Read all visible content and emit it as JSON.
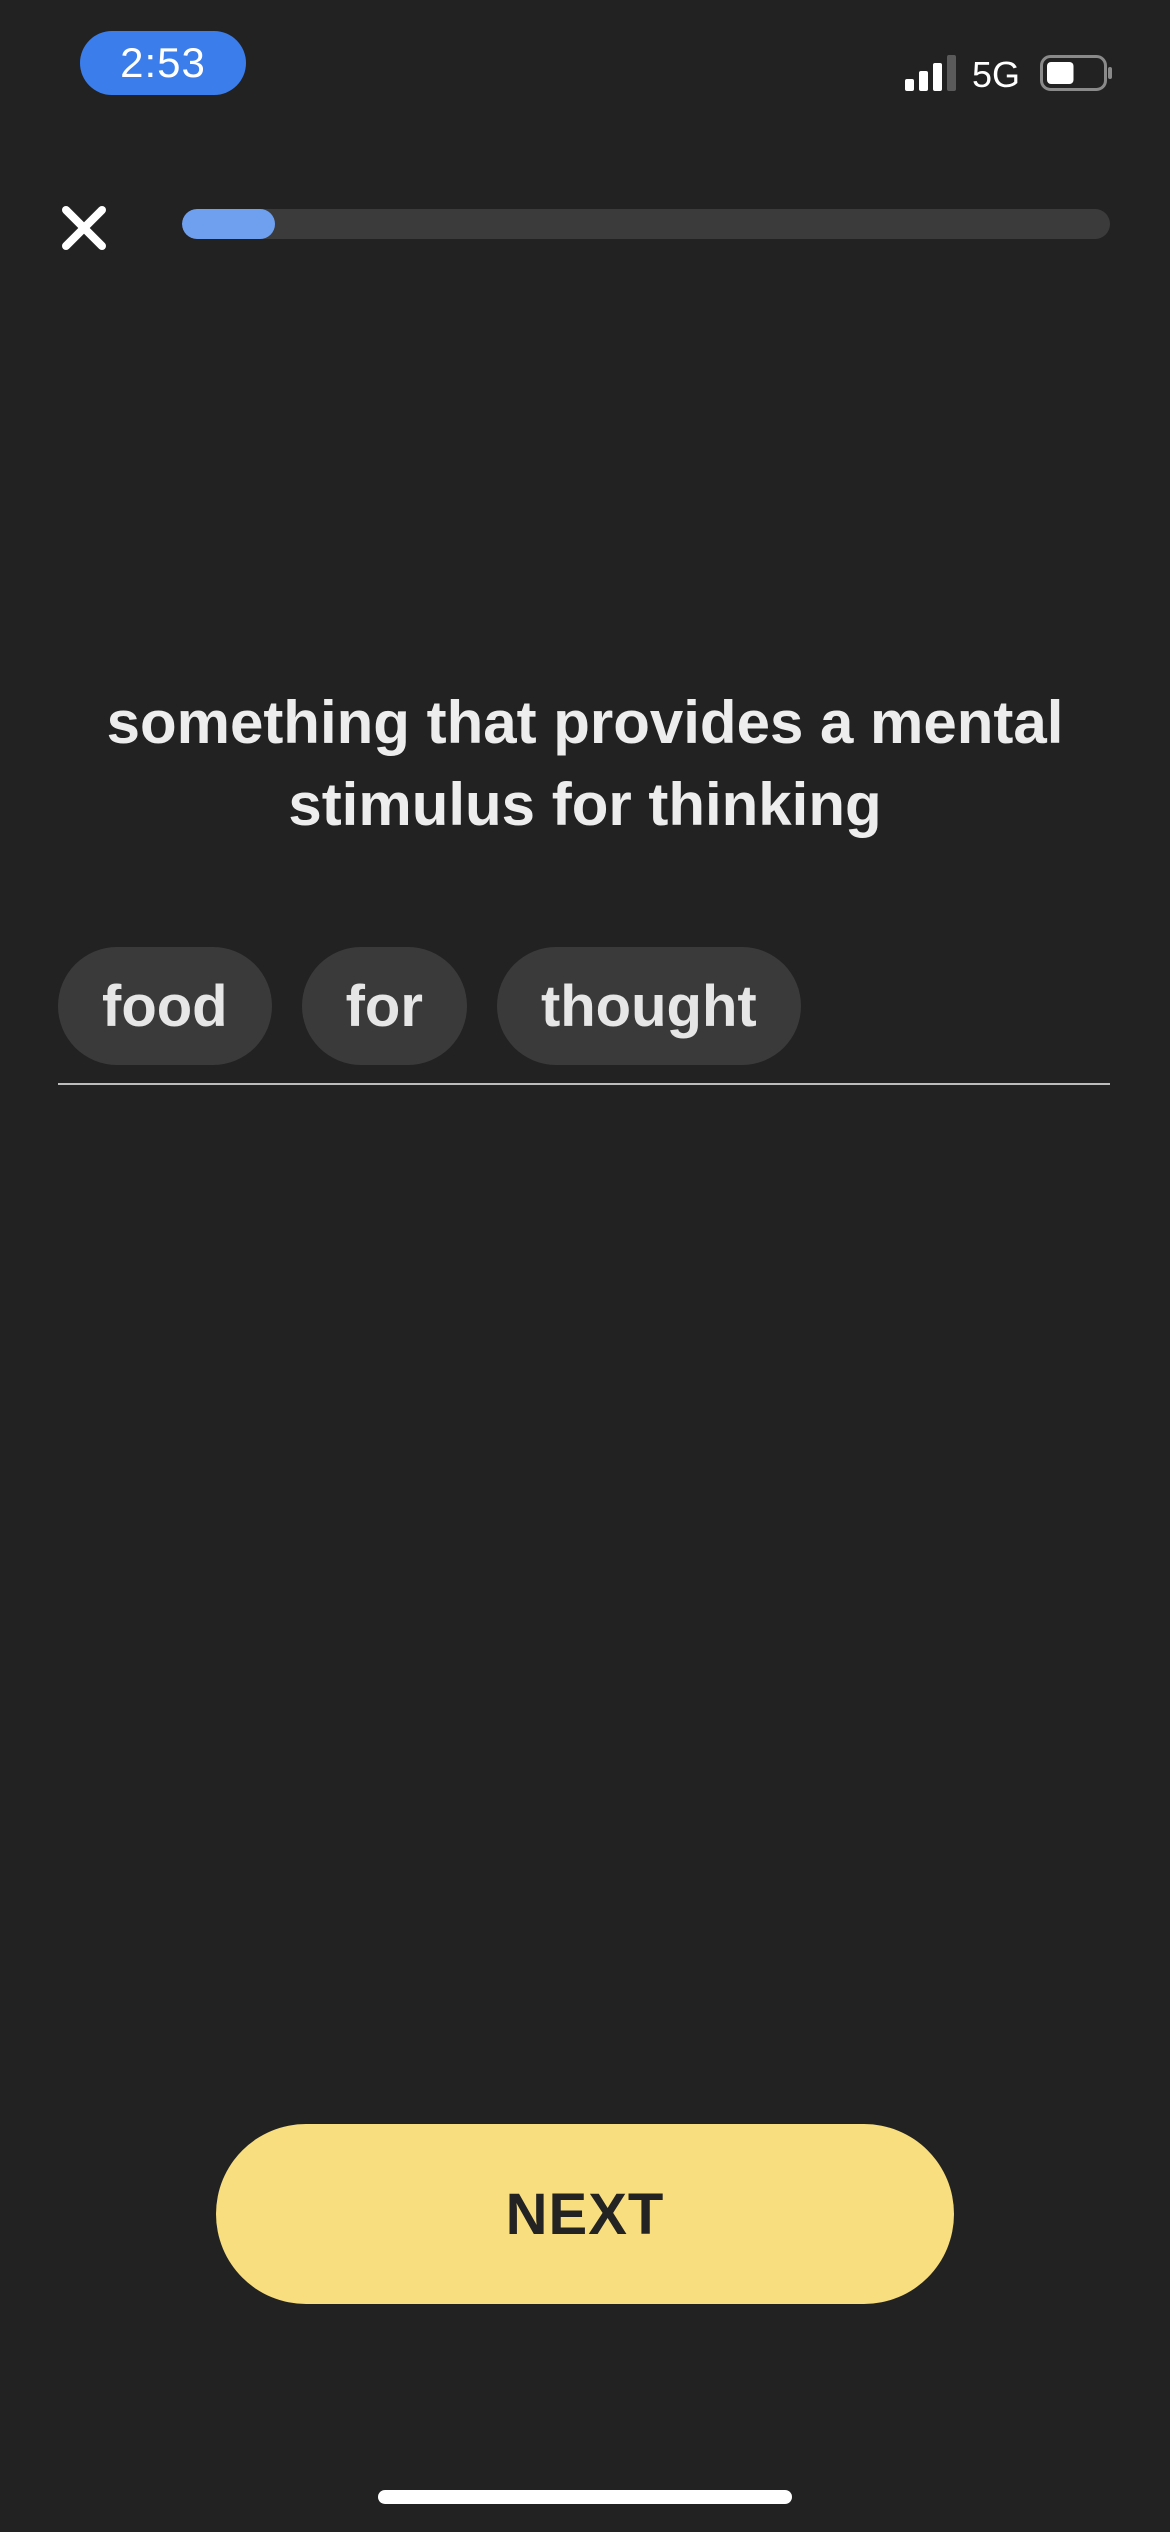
{
  "status_bar": {
    "time": "2:53",
    "network": "5G",
    "signal_icon": "cellular-signal-icon",
    "battery_icon": "battery-icon",
    "battery_level": 0.5
  },
  "header": {
    "close_icon": "close-icon",
    "progress": 0.1
  },
  "question": {
    "prompt": "something that provides a mental stimulus for thinking"
  },
  "answer": {
    "chips": [
      "food",
      "for",
      "thought"
    ]
  },
  "footer": {
    "next_label": "NEXT"
  },
  "colors": {
    "background": "#222222",
    "accent_blue": "#3A7DEB",
    "progress_fill": "#6FA0F0",
    "chip_bg": "#3A3A3A",
    "next_button": "#F8DE7E"
  }
}
